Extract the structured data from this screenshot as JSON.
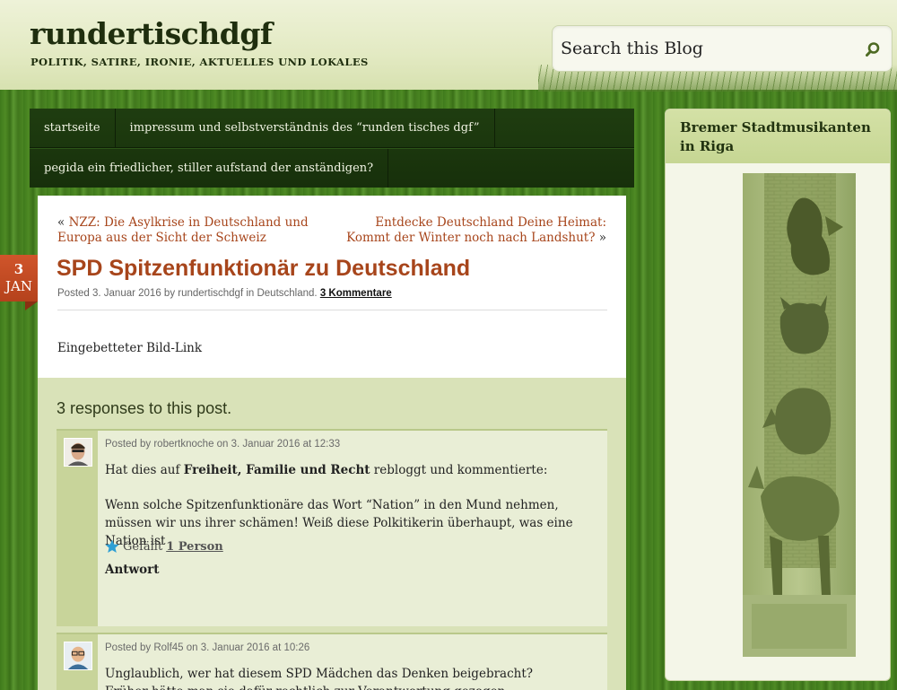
{
  "header": {
    "site_title": "rundertischdgf",
    "site_description": "POLITIK, SATIRE, IRONIE, AKTUELLES UND LOKALES",
    "search_placeholder": "Search this Blog"
  },
  "nav": {
    "items": [
      {
        "label": "startseite"
      },
      {
        "label": "impressum und selbstverständnis des “runden tisches dgf”"
      },
      {
        "label": "pegida ein friedlicher, stiller aufstand der anständigen?"
      }
    ]
  },
  "post": {
    "prev_marker": "«",
    "prev_link": "NZZ: Die Asylkrise in Deutschland und Europa aus der Sicht der Schweiz",
    "next_link": "Entdecke Deutschland Deine Heimat: Kommt der Winter noch nach Landshut?",
    "next_marker": "»",
    "date_day": "3",
    "date_month": "JAN",
    "title": "SPD Spitzenfunktionär zu Deutschland",
    "meta_prefix": "Posted 3. Januar 2016 by rundertischdgf in Deutschland.",
    "meta_comments": "3 Kommentare",
    "body": "Eingebetteter Bild-Link"
  },
  "comments": {
    "title": "3 responses to this post.",
    "items": [
      {
        "meta": "Posted by robertknoche on 3. Januar 2016 at 12:33",
        "reblog_prefix": "Hat dies auf",
        "reblog_source": "Freiheit, Familie und Recht",
        "reblog_suffix": "rebloggt und kommentierte:",
        "text": "Wenn solche Spitzenfunktionäre das Wort “Nation” in den Mund nehmen, müssen wir uns ihrer schämen! Weiß diese Polkitikerin überhaupt, was eine Nation ist",
        "like_label": "Gefällt",
        "like_count": "1 Person",
        "reply_label": "Antwort"
      },
      {
        "meta": "Posted by Rolf45 on 3. Januar 2016 at 10:26",
        "text": "Unglaublich, wer hat diesem SPD Mädchen das Denken beigebracht?",
        "text_cut": "Früher hätte man sie dafür rechtlich zur Verantwortung gezogen."
      }
    ]
  },
  "sidebar": {
    "widget_title": "Bremer Stadtmusikanten in Riga"
  },
  "colors": {
    "link": "#a7451b",
    "nav_bg": "#1f3d10",
    "date_badge": "#c44a22",
    "widget_head": "#cfdd9f"
  },
  "icons": {
    "search": "search-icon",
    "star": "star-icon"
  }
}
